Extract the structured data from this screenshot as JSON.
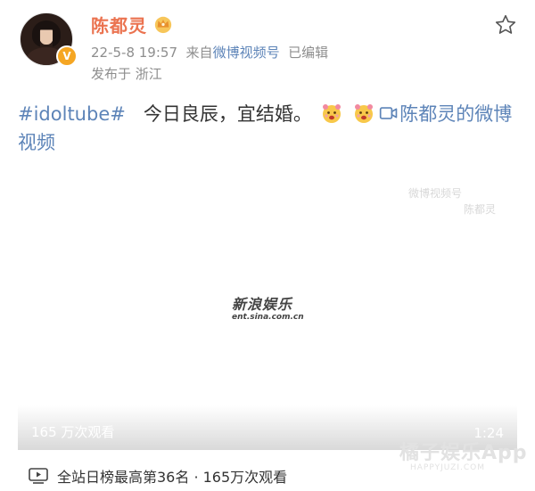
{
  "user": {
    "name": "陈都灵",
    "verified_badge": "V",
    "crown_icon": "crown-icon"
  },
  "meta": {
    "timestamp": "22-5-8 19:57",
    "source_prefix": "来自",
    "source_name": "微博视频号",
    "edited": "已编辑",
    "location": "发布于 浙江"
  },
  "post": {
    "hashtag": "#idoltube#",
    "text": "今日良辰，宜结婚。",
    "video_link": "陈都灵的微博视频"
  },
  "video": {
    "watermark_top": "微博视频号",
    "watermark_top_sub": "陈都灵",
    "logo_cn": "新浪娱乐",
    "logo_en": "ent.sina.com.cn",
    "views": "165 万次观看",
    "duration": "1:24"
  },
  "rank": {
    "text": "全站日榜最高第36名 · 165万次观看"
  },
  "watermark": {
    "cn": "橘子娱乐App",
    "en": "HAPPYJUZI.COM"
  },
  "colors": {
    "username": "#eb7350",
    "link": "#5d84b8",
    "meta": "#8e8e8e"
  }
}
